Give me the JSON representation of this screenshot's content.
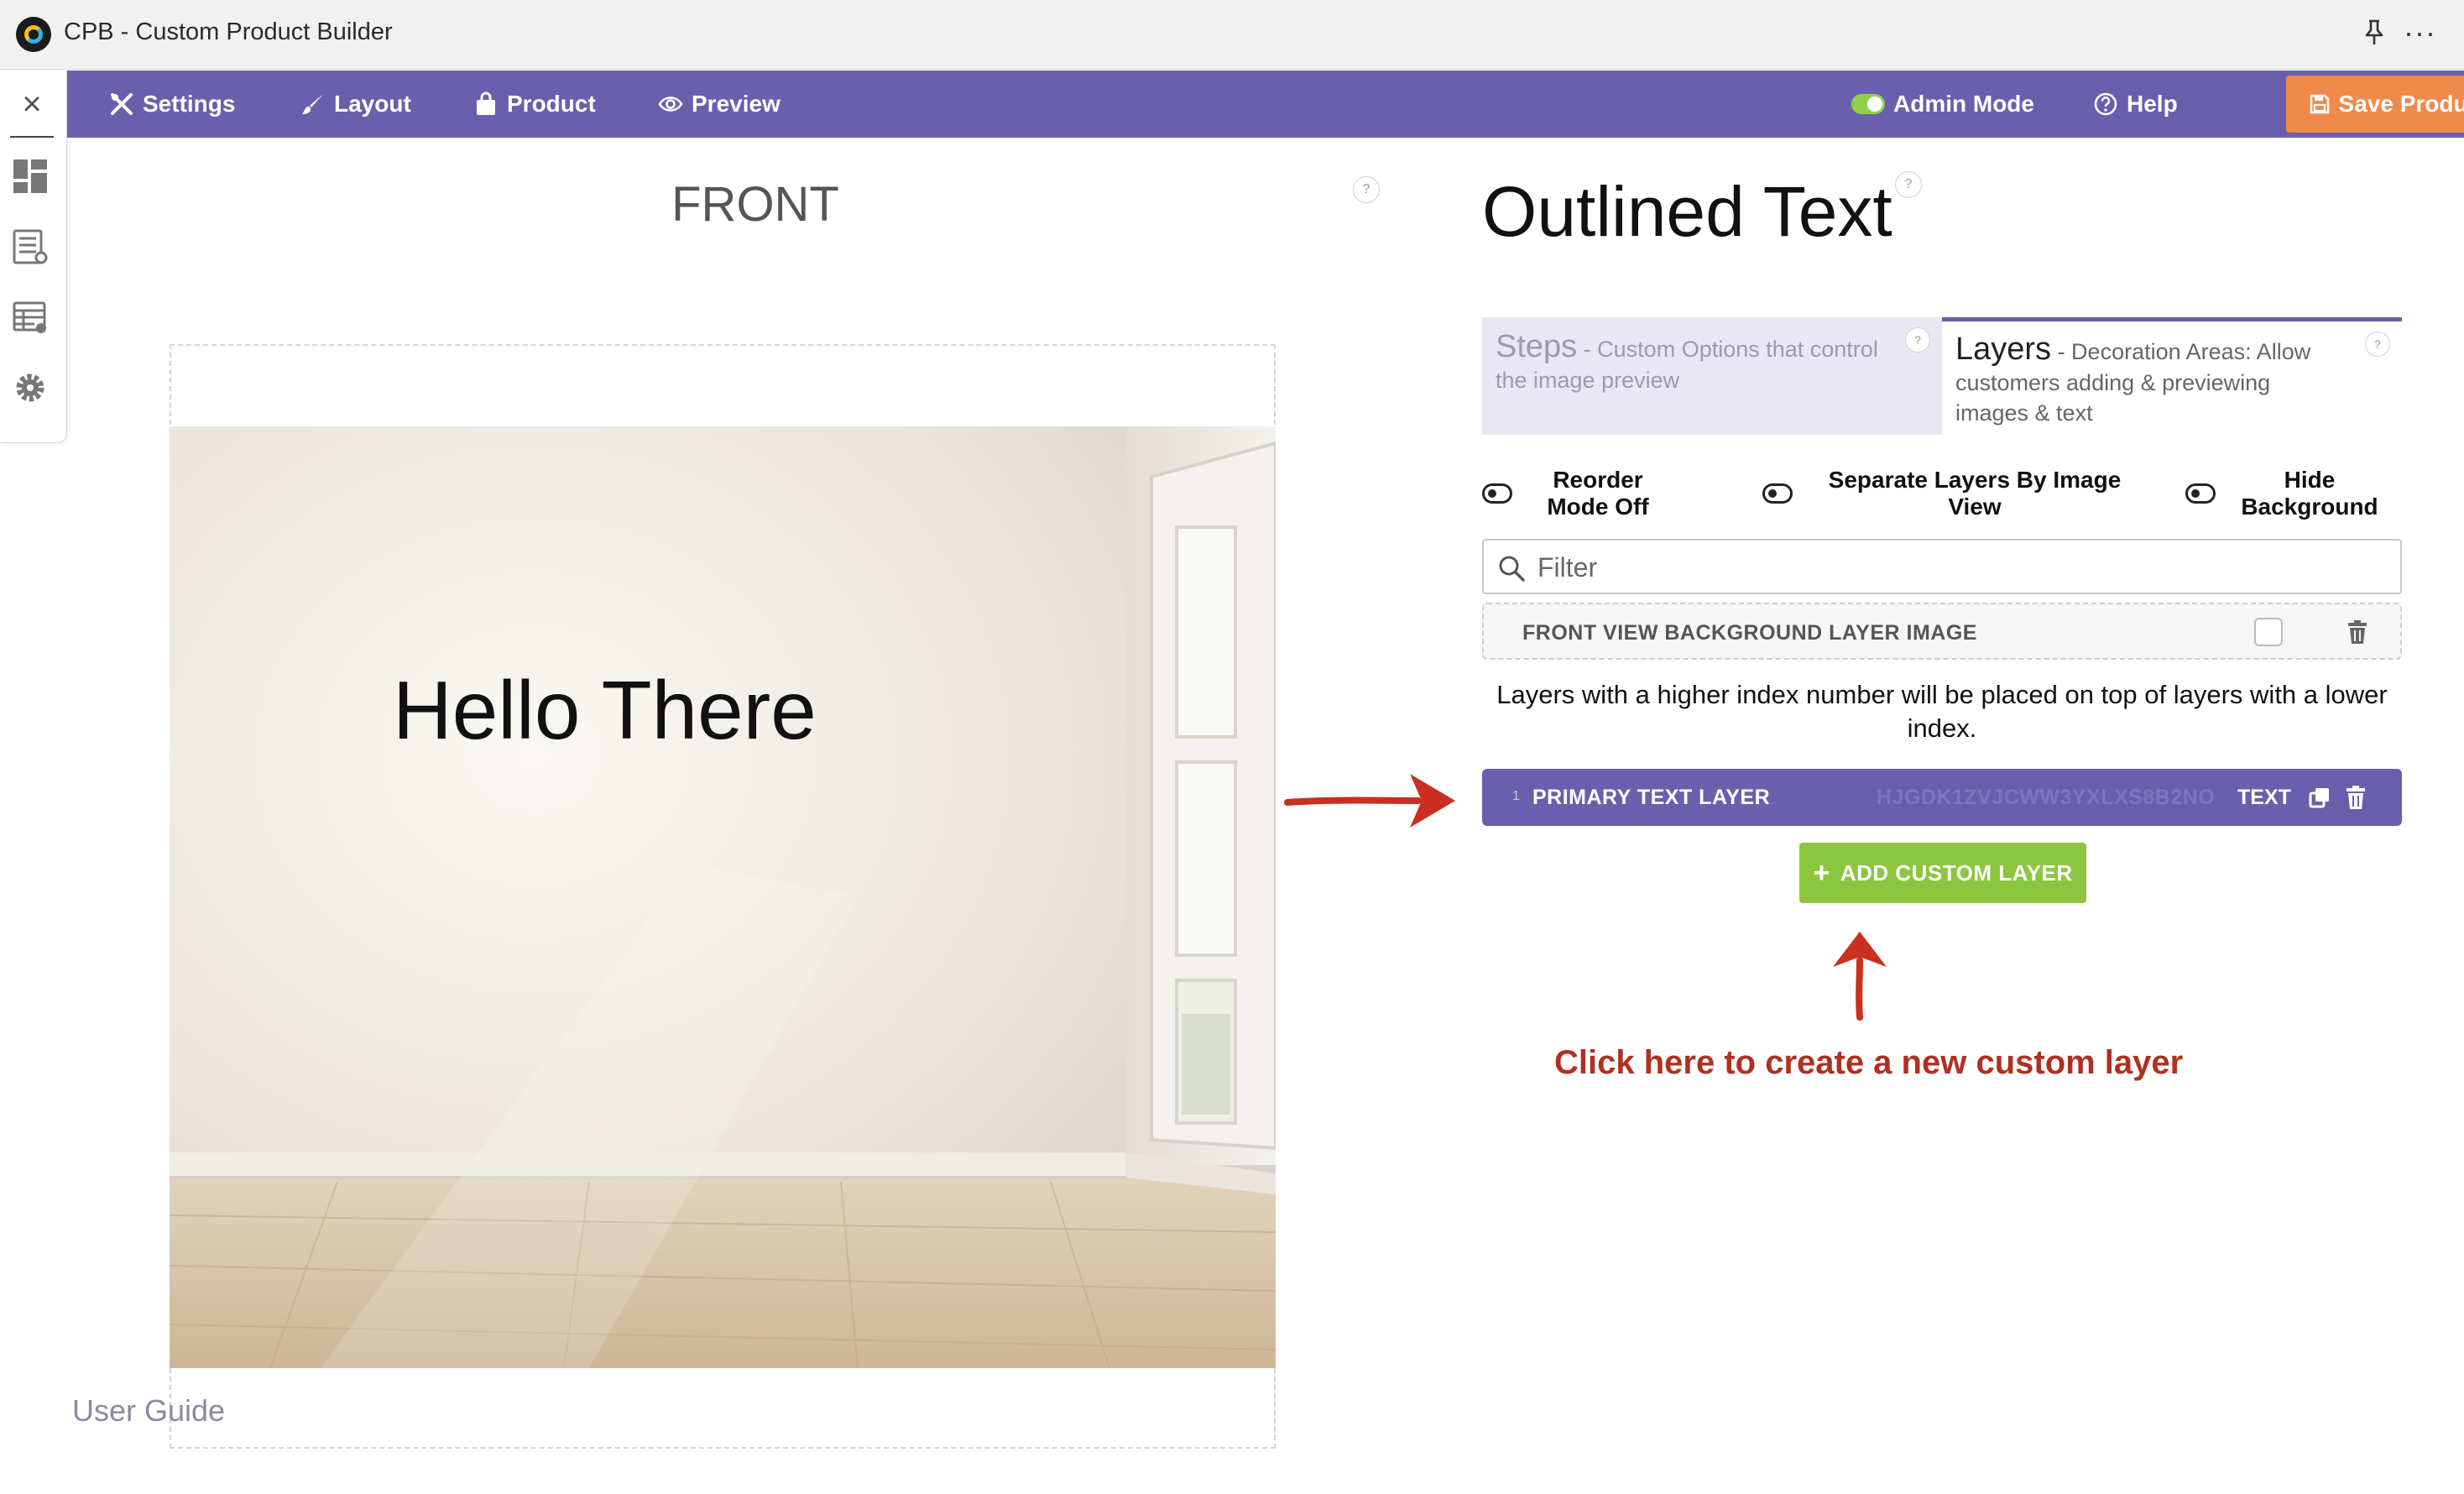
{
  "window": {
    "title": "CPB - Custom Product Builder"
  },
  "toolbar": {
    "settings": "Settings",
    "layout": "Layout",
    "product": "Product",
    "preview": "Preview",
    "admin_mode": "Admin Mode",
    "help": "Help",
    "save": "Save Product"
  },
  "canvas": {
    "view_label": "FRONT",
    "text": "Hello There",
    "user_guide": "User Guide"
  },
  "panel": {
    "title": "Outlined Text",
    "tabs": [
      {
        "title": "Steps",
        "desc": " - Custom Options that control the image preview"
      },
      {
        "title": "Layers",
        "desc": " - Decoration Areas: Allow customers adding & previewing images & text"
      }
    ],
    "options": {
      "reorder": "Reorder Mode Off",
      "separate": "Separate Layers By Image View",
      "hide_bg": "Hide Background"
    },
    "filter_placeholder": "Filter",
    "background_layer": "FRONT VIEW BACKGROUND LAYER IMAGE",
    "note": "Layers with a higher index number will be placed on top of layers with a lower index.",
    "layers": [
      {
        "index": "1",
        "name": "PRIMARY TEXT LAYER",
        "id": "HJGDK1ZVJCWW3YXLXS8B2NO",
        "type": "TEXT"
      }
    ],
    "add_button": "ADD CUSTOM LAYER",
    "help_mark": "?"
  },
  "annotations": {
    "hint": "Click here to create a new custom layer"
  },
  "colors": {
    "toolbar": "#6a5fad",
    "save_button": "#f08a4b",
    "add_button": "#8cc63f",
    "annotation": "#b03020"
  }
}
